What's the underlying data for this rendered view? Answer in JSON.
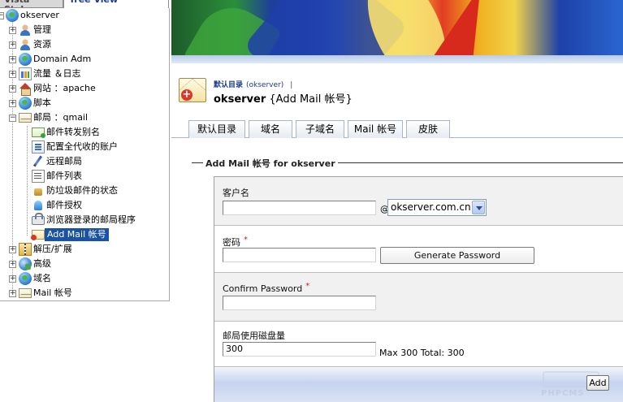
{
  "left_panel": {
    "tabs": [
      {
        "label": "Vista Style",
        "active": false
      },
      {
        "label": "Tree View",
        "active": true
      }
    ],
    "root": "okserver",
    "items": [
      {
        "label": "管理",
        "expander": "+",
        "icon": "user-admin-icon"
      },
      {
        "label": "资源",
        "expander": "+",
        "icon": "resources-icon"
      },
      {
        "label": "Domain Adm",
        "expander": "+",
        "icon": "domain-globe-icon"
      },
      {
        "label": "流量 ＆日志",
        "expander": "+",
        "icon": "traffic-chart-icon"
      },
      {
        "label": "网站 ：apache",
        "expander": "+",
        "icon": "website-home-icon"
      },
      {
        "label": "脚本",
        "expander": "+",
        "icon": "script-icon"
      },
      {
        "label": "邮局 ：qmail",
        "expander": "−",
        "icon": "mail-icon"
      },
      {
        "label": "解压/扩展",
        "expander": "+",
        "icon": "zip-icon"
      },
      {
        "label": "高级",
        "expander": "+",
        "icon": "advanced-icon"
      },
      {
        "label": "域名",
        "expander": "+",
        "icon": "domain-icon"
      },
      {
        "label": "Mail 帐号",
        "expander": "+",
        "icon": "mail-account-icon"
      }
    ],
    "mail_children": [
      {
        "label": "邮件转发别名",
        "icon": "mail-forward-icon"
      },
      {
        "label": "配置全代收的账户",
        "icon": "catchall-config-icon"
      },
      {
        "label": "远程邮局",
        "icon": "remote-mail-icon"
      },
      {
        "label": "邮件列表",
        "icon": "mailing-list-icon"
      },
      {
        "label": "防垃圾邮件的状态",
        "icon": "antispam-icon"
      },
      {
        "label": "邮件授权",
        "icon": "mail-auth-icon"
      },
      {
        "label": "浏览器登录的邮局程序",
        "icon": "webmail-lock-icon"
      },
      {
        "label": "Add Mail 帐号",
        "icon": "add-mail-icon",
        "selected": true
      }
    ]
  },
  "header": {
    "breadcrumb_link": "默认目录",
    "breadcrumb_server": "(okserver)",
    "breadcrumb_sep": "|",
    "title_server": "okserver",
    "title_rest": "{Add Mail 帐号}"
  },
  "tabs": [
    "默认目录",
    "域名",
    "子域名",
    "Mail 帐号",
    "皮肤"
  ],
  "form": {
    "legend": "Add Mail 帐号  for okserver",
    "customer_label": "客户名",
    "customer_value": "",
    "at": "@",
    "domain_selected": "okserver.com.cn",
    "password_label": "密码",
    "password_required": "*",
    "password_value": "",
    "generate_label": "Generate Password",
    "confirm_label": "Confirm Password",
    "confirm_required": "*",
    "confirm_value": "",
    "quota_label": "邮局使用磁盘量",
    "quota_value": "300",
    "quota_note": "Max 300 Total: 300",
    "add_label": "Add"
  },
  "watermark": "PHPCMS"
}
